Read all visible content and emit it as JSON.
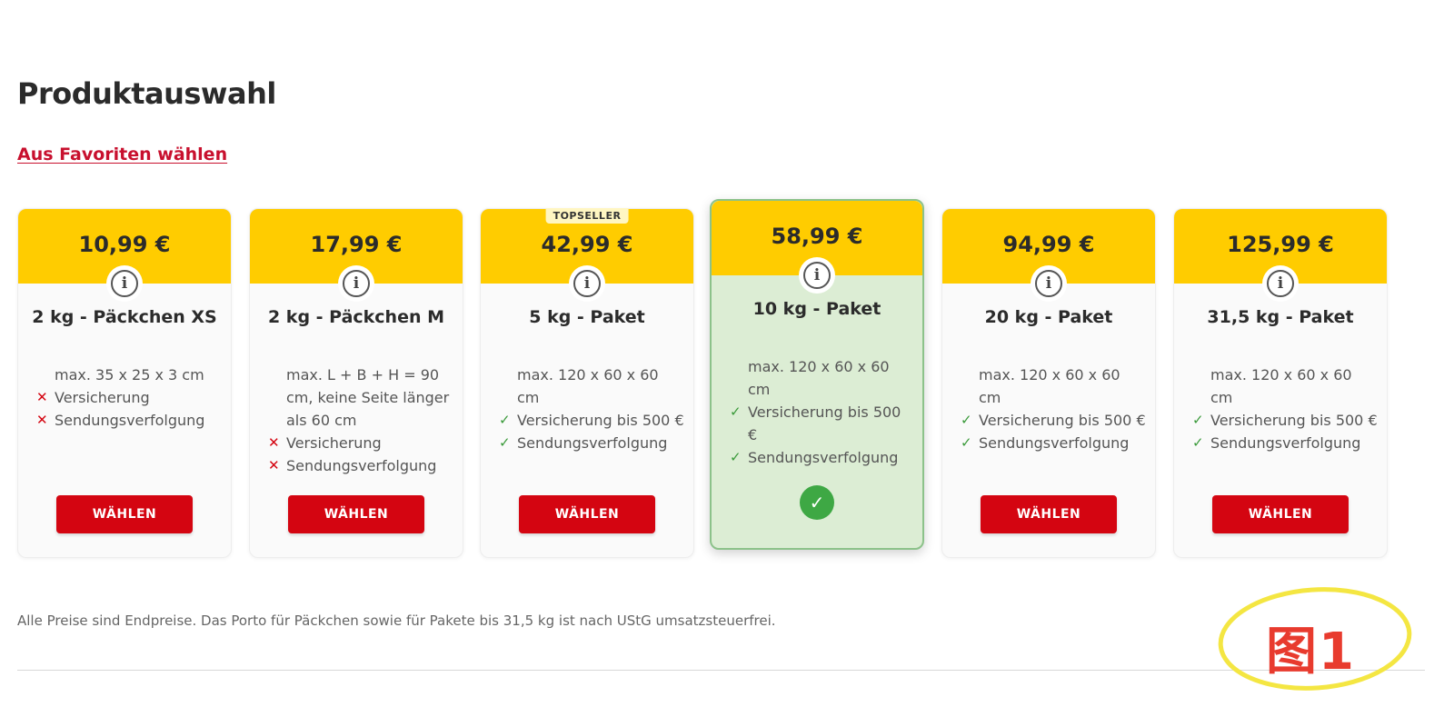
{
  "page": {
    "title": "Produktauswahl",
    "favorites_link": "Aus Favoriten wählen",
    "footnote": "Alle Preise sind Endpreise. Das Porto für Päckchen sowie für Pakete bis 31,5 kg ist nach UStG umsatzsteuerfrei.",
    "annotation": "图1"
  },
  "products": [
    {
      "price": "10,99 €",
      "name": "2 kg - Päckchen XS",
      "dimensions": "max. 35 x 25 x 3 cm",
      "features": [
        {
          "mark": "✕",
          "text": "Versicherung"
        },
        {
          "mark": "✕",
          "text": "Sendungsverfolgung"
        }
      ],
      "button": "WÄHLEN"
    },
    {
      "price": "17,99 €",
      "name": "2 kg - Päckchen M",
      "dimensions": "max. L + B + H = 90 cm, keine Seite länger als 60 cm",
      "features": [
        {
          "mark": "✕",
          "text": "Versicherung"
        },
        {
          "mark": "✕",
          "text": "Sendungsverfolgung"
        }
      ],
      "button": "WÄHLEN"
    },
    {
      "badge": "TOPSELLER",
      "price": "42,99 €",
      "name": "5 kg - Paket",
      "dimensions": "max. 120 x 60 x 60 cm",
      "features": [
        {
          "mark": "✓",
          "text": "Versicherung bis 500 €"
        },
        {
          "mark": "✓",
          "text": "Sendungsverfolgung"
        }
      ],
      "button": "WÄHLEN"
    },
    {
      "price": "58,99 €",
      "name": "10 kg - Paket",
      "dimensions": "max. 120 x 60 x 60 cm",
      "features": [
        {
          "mark": "✓",
          "text": "Versicherung bis 500 €"
        },
        {
          "mark": "✓",
          "text": "Sendungsverfolgung"
        }
      ],
      "selected_icon": "✓"
    },
    {
      "price": "94,99 €",
      "name": "20 kg - Paket",
      "dimensions": "max. 120 x 60 x 60 cm",
      "features": [
        {
          "mark": "✓",
          "text": "Versicherung bis 500 €"
        },
        {
          "mark": "✓",
          "text": "Sendungsverfolgung"
        }
      ],
      "button": "WÄHLEN"
    },
    {
      "price": "125,99 €",
      "name": "31,5 kg - Paket",
      "dimensions": "max. 120 x 60 x 60 cm",
      "features": [
        {
          "mark": "✓",
          "text": "Versicherung bis 500 €"
        },
        {
          "mark": "✓",
          "text": "Sendungsverfolgung"
        }
      ],
      "button": "WÄHLEN"
    }
  ],
  "info_icon": "i",
  "colors": {
    "brand_yellow": "#ffcc00",
    "brand_red": "#d40511",
    "selected_bg": "#dcedd4",
    "check_green": "#3ea844"
  }
}
